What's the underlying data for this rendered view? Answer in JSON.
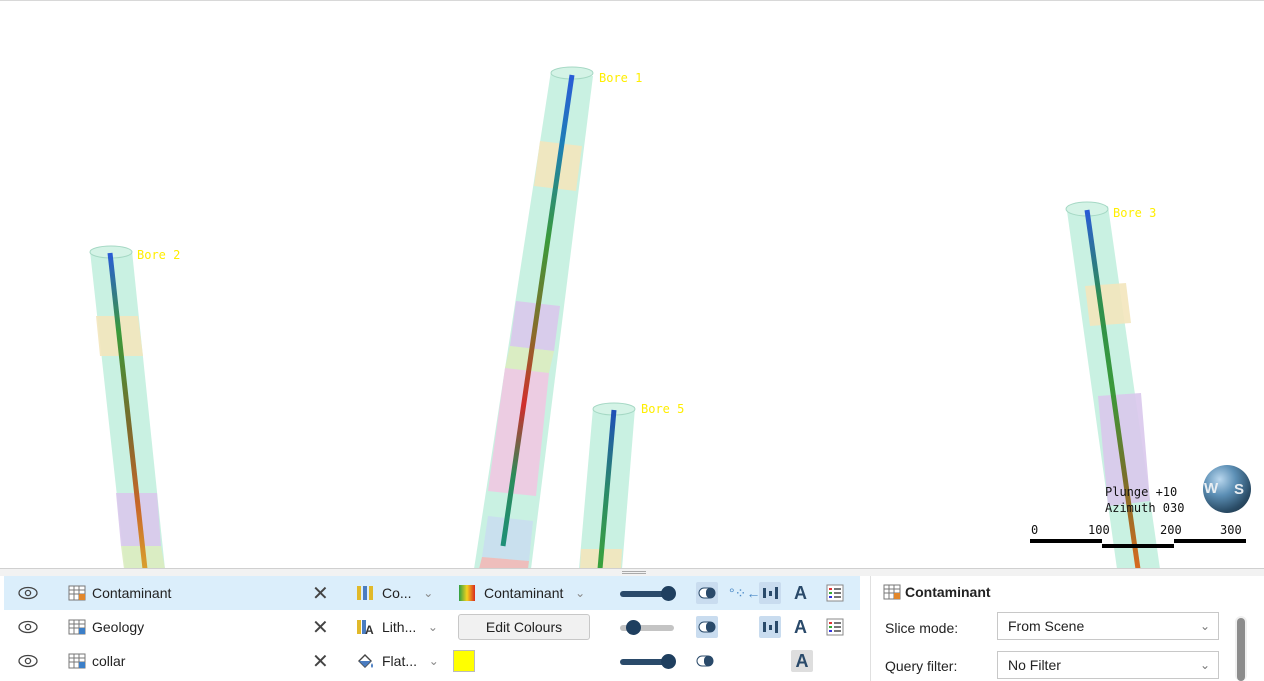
{
  "scene": {
    "bores": [
      {
        "label": "Bore 1"
      },
      {
        "label": "Bore 2"
      },
      {
        "label": "Bore 3"
      },
      {
        "label": "Bore 5"
      }
    ],
    "plunge": "Plunge +10",
    "azimuth": "Azimuth 030",
    "scale_ticks": [
      "0",
      "100",
      "200",
      "300"
    ],
    "compass_letters": [
      "W",
      "S"
    ]
  },
  "layers": [
    {
      "name": "Contaminant",
      "display": "Co...",
      "legend": "Contaminant",
      "selected": true,
      "opacity": 1.0
    },
    {
      "name": "Geology",
      "display": "Lith...",
      "button": "Edit Colours",
      "selected": false,
      "opacity": 0.2
    },
    {
      "name": "collar",
      "display": "Flat...",
      "swatch": "#ffff00",
      "selected": false,
      "opacity": 1.0
    }
  ],
  "properties": {
    "title": "Contaminant",
    "slice_mode_label": "Slice mode:",
    "slice_mode_value": "From Scene",
    "query_filter_label": "Query filter:",
    "query_filter_value": "No Filter"
  },
  "icons": {
    "visibility": "eye-icon",
    "table": "table-icon",
    "remove": "close-icon",
    "dropdown": "chevron-down-icon"
  },
  "colors": {
    "bore_label": "#ffee00",
    "selection": "#dbeefb",
    "collar_swatch": "#ffff00"
  }
}
